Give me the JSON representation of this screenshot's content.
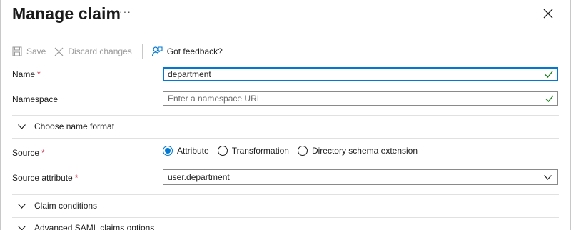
{
  "header": {
    "title": "Manage claim",
    "more_label": "···"
  },
  "toolbar": {
    "save_label": "Save",
    "discard_label": "Discard changes",
    "feedback_label": "Got feedback?"
  },
  "form": {
    "name": {
      "label": "Name",
      "required_mark": "*",
      "value": "department"
    },
    "namespace": {
      "label": "Namespace",
      "placeholder": "Enter a namespace URI"
    },
    "name_format_section": "Choose name format",
    "source": {
      "label": "Source",
      "required_mark": "*",
      "options": [
        "Attribute",
        "Transformation",
        "Directory schema extension"
      ],
      "selected": "Attribute"
    },
    "source_attribute": {
      "label": "Source attribute",
      "required_mark": "*",
      "value": "user.department"
    },
    "claim_conditions_section": "Claim conditions",
    "advanced_section": "Advanced SAML claims options"
  },
  "colors": {
    "accent": "#0078d4",
    "valid_check": "#107c10",
    "required": "#c4314b"
  }
}
